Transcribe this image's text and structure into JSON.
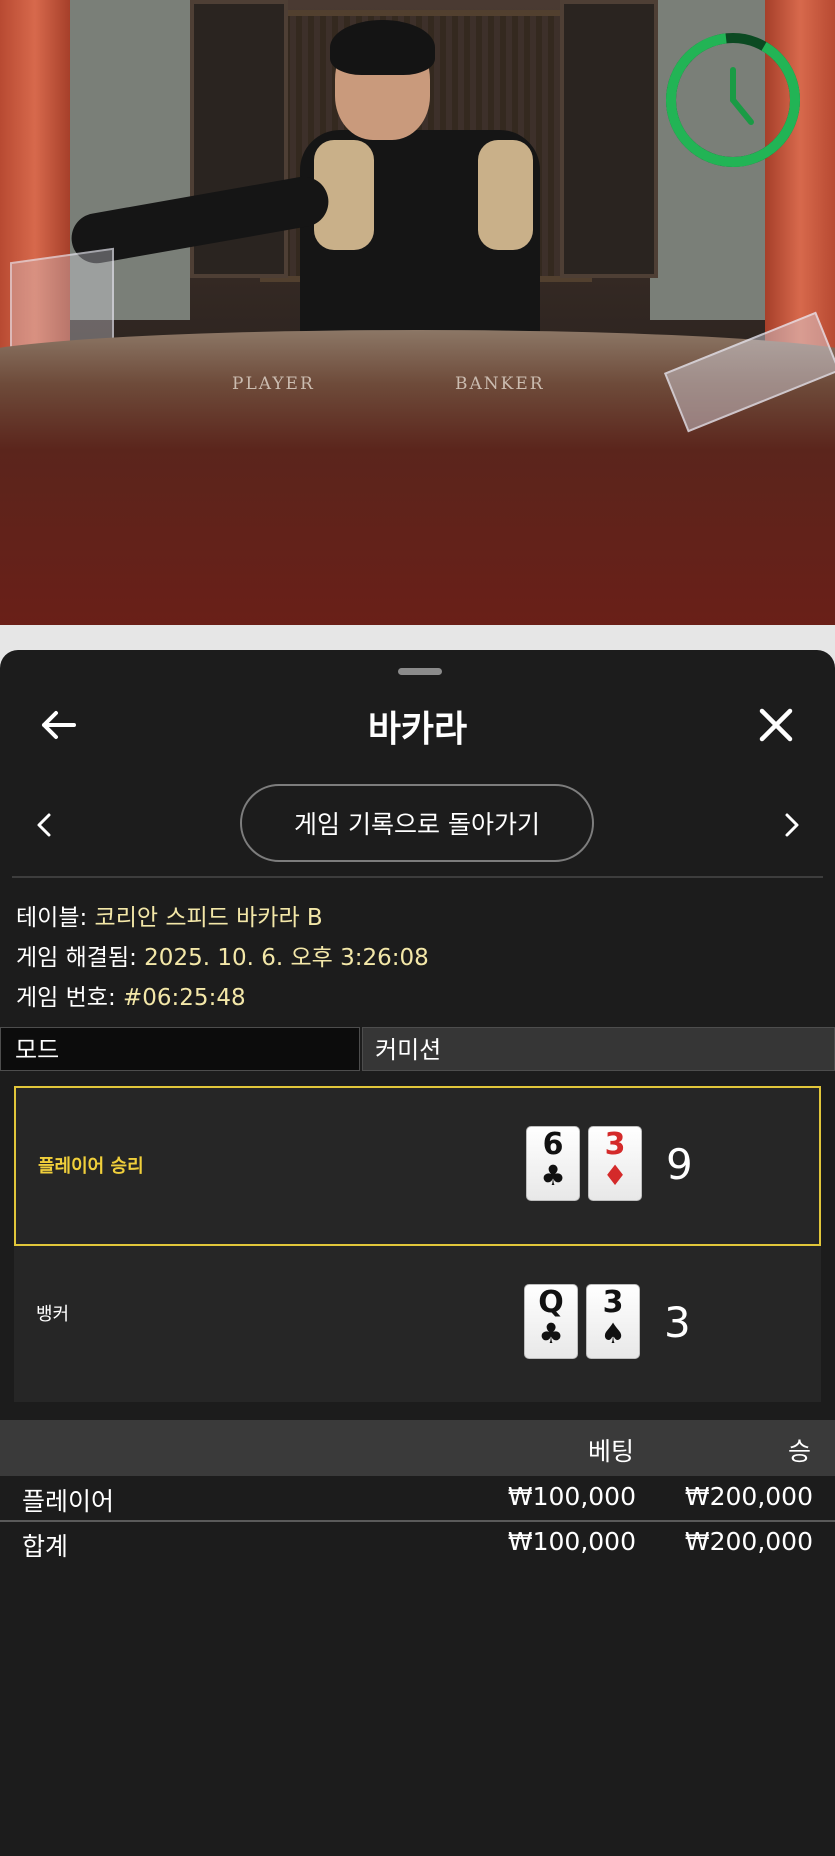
{
  "video": {
    "table_labels": {
      "player": "PLAYER",
      "banker": "BANKER"
    },
    "timer": {
      "icon": "clock-icon",
      "color": "#22b455"
    }
  },
  "sheet": {
    "title": "바카라",
    "back_icon": "arrow-left-icon",
    "close_icon": "close-icon",
    "prev_icon": "chevron-left-icon",
    "next_icon": "chevron-right-icon",
    "back_to_history": "게임 기록으로 돌아가기"
  },
  "info": {
    "table_label": "테이블: ",
    "table_value": "코리안 스피드 바카라 B",
    "resolved_label": "게임 해결됨: ",
    "resolved_value": "2025. 10. 6. 오후 3:26:08",
    "number_label": "게임 번호: ",
    "number_value": "#06:25:48"
  },
  "tabs": {
    "mode": "모드",
    "commission": "커미션"
  },
  "result": {
    "player": {
      "label": "플레이어 승리",
      "cards": [
        {
          "rank": "6",
          "suit": "♣",
          "color": "black"
        },
        {
          "rank": "3",
          "suit": "♦",
          "color": "red"
        }
      ],
      "score": "9"
    },
    "banker": {
      "label": "뱅커",
      "cards": [
        {
          "rank": "Q",
          "suit": "♣",
          "color": "black"
        },
        {
          "rank": "3",
          "suit": "♠",
          "color": "black"
        }
      ],
      "score": "3"
    },
    "accent_color": "#e1c63a"
  },
  "bets": {
    "headers": {
      "bet": "베팅",
      "win": "승"
    },
    "rows": [
      {
        "name": "플레이어",
        "bet": "₩100,000",
        "win": "₩200,000"
      }
    ],
    "total": {
      "name": "합계",
      "bet": "₩100,000",
      "win": "₩200,000"
    }
  }
}
